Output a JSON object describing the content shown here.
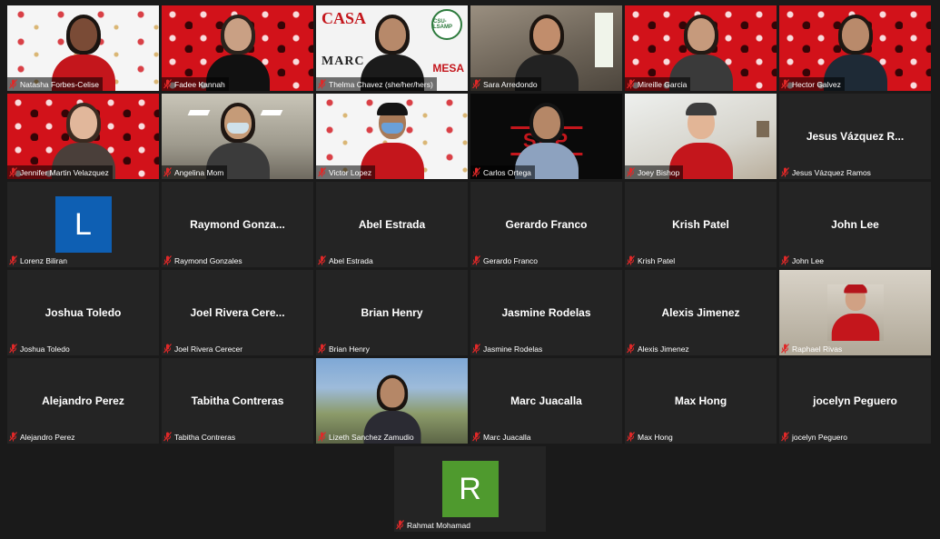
{
  "participants": [
    {
      "name": "Natasha Forbes-Celise",
      "display": "",
      "kind": "video",
      "backdrop": "bg-white-logos",
      "skin": "#7a4b36",
      "hair": "#1a1410",
      "shirt": "#c4161c"
    },
    {
      "name": "Fadee Kannah",
      "display": "",
      "kind": "video",
      "backdrop": "bg-mesa",
      "skin": "#c9a084",
      "hair": "#2a221c",
      "shirt": "#111111"
    },
    {
      "name": "Thelma Chavez (she/her/hers)",
      "display": "",
      "kind": "casa",
      "backdrop": "bg-casa",
      "skin": "#b7896a",
      "hair": "#1c1612",
      "shirt": "#1b1b1b",
      "logos": {
        "casa": "CASA",
        "marc": "MARC",
        "mesa": "MESA",
        "lsamp": "CSU-LSAMP"
      }
    },
    {
      "name": "Sara Arredondo",
      "display": "",
      "kind": "video",
      "backdrop": "bg-room",
      "skin": "#c18d6c",
      "hair": "#1b140f",
      "shirt": "#222222",
      "speaking": true
    },
    {
      "name": "Mireille Garcia",
      "display": "",
      "kind": "video",
      "backdrop": "bg-mesa",
      "skin": "#c69a7c",
      "hair": "#231a14",
      "shirt": "#3a3a3a"
    },
    {
      "name": "Hector Galvez",
      "display": "",
      "kind": "video",
      "backdrop": "bg-mesa",
      "skin": "#b98a6b",
      "hair": "#1d1712",
      "shirt": "#1e2a36"
    },
    {
      "name": "Jennifer Martin Velazquez",
      "display": "",
      "kind": "video",
      "backdrop": "bg-mesa",
      "skin": "#e1b79b",
      "hair": "#3a2a20",
      "shirt": "#4a3f3a"
    },
    {
      "name": "Angelina Mom",
      "display": "",
      "kind": "mask",
      "backdrop": "bg-office",
      "skin": "#c59b78",
      "hair": "#1f1713",
      "shirt": "#3b3b3b",
      "mask": "#cfe1ea"
    },
    {
      "name": "Victor Lopez",
      "display": "",
      "kind": "mask",
      "backdrop": "bg-white-logos",
      "skin": "#a87a58",
      "hair": "#111111",
      "shirt": "#c4161c",
      "mask": "#6aa0d8",
      "cap": "#141414"
    },
    {
      "name": "Carlos Ortega",
      "display": "",
      "kind": "shp",
      "backdrop": "bg-black-logo",
      "skin": "#b58767",
      "hair": "#151515",
      "shirt": "#8da2bf",
      "logo": "SHP"
    },
    {
      "name": "Joey Bishop",
      "display": "",
      "kind": "cap",
      "backdrop": "bg-bright",
      "skin": "#e2b596",
      "hair": "#2a2a2a",
      "shirt": "#c4161c",
      "cap": "#3c3c3c"
    },
    {
      "name": "Jesus Vázquez Ramos",
      "display": "Jesus Vázquez R...",
      "kind": "name"
    },
    {
      "name": "Lorenz Biliran",
      "display": "L",
      "kind": "avatar",
      "color": "#0e5fb3"
    },
    {
      "name": "Raymond Gonzales",
      "display": "Raymond  Gonza...",
      "kind": "name"
    },
    {
      "name": "Abel Estrada",
      "display": "Abel Estrada",
      "kind": "name"
    },
    {
      "name": "Gerardo Franco",
      "display": "Gerardo Franco",
      "kind": "name"
    },
    {
      "name": "Krish Patel",
      "display": "Krish Patel",
      "kind": "name"
    },
    {
      "name": "John Lee",
      "display": "John Lee",
      "kind": "name"
    },
    {
      "name": "Joshua Toledo",
      "display": "Joshua Toledo",
      "kind": "name"
    },
    {
      "name": "Joel Rivera Cerecer",
      "display": "Joel Rivera Cere...",
      "kind": "name"
    },
    {
      "name": "Brian Henry",
      "display": "Brian Henry",
      "kind": "name"
    },
    {
      "name": "Jasmine Rodelas",
      "display": "Jasmine Rodelas",
      "kind": "name"
    },
    {
      "name": "Alexis Jimenez",
      "display": "Alexis Jimenez",
      "kind": "name"
    },
    {
      "name": "Raphael Rivas",
      "display": "",
      "kind": "photo",
      "backdrop": "bg-lab",
      "skin": "#d0a184",
      "hair": "#2a1e18",
      "shirt": "#c4161c",
      "cap": "#b5141b"
    },
    {
      "name": "Alejandro Perez",
      "display": "Alejandro Perez",
      "kind": "name"
    },
    {
      "name": "Tabitha Contreras",
      "display": "Tabitha Contreras",
      "kind": "name"
    },
    {
      "name": "Lizeth Sanchez Zamudio",
      "display": "",
      "kind": "photo-wide",
      "backdrop": "bg-outdoor",
      "skin": "#b58767",
      "hair": "#1a1410",
      "shirt": "#2b2b33"
    },
    {
      "name": "Marc Juacalla",
      "display": "Marc Juacalla",
      "kind": "name"
    },
    {
      "name": "Max Hong",
      "display": "Max Hong",
      "kind": "name"
    },
    {
      "name": "jocelyn Peguero",
      "display": "jocelyn Peguero",
      "kind": "name"
    },
    {
      "name": "Rahmat Mohamad",
      "display": "R",
      "kind": "avatar",
      "color": "#4f9a2e"
    }
  ],
  "icons": {
    "muted": "muted-mic-icon"
  },
  "colors": {
    "muted_icon": "#e02828",
    "speaking_border": "#d8e36a",
    "tile_bg": "#242424",
    "app_bg": "#1a1a1a"
  }
}
